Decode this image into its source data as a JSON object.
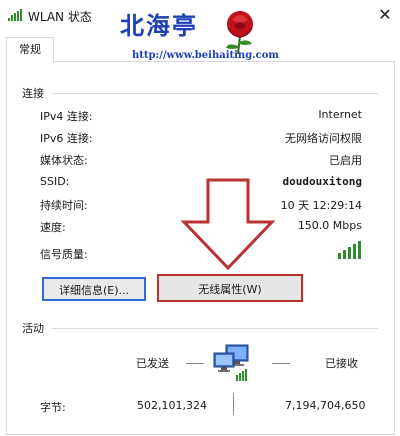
{
  "window": {
    "title": "WLAN 状态",
    "close_glyph": "✕"
  },
  "watermark": {
    "text": "北海亭",
    "url": "http://www.beihaiting.com"
  },
  "tabs": [
    {
      "label": "常规"
    }
  ],
  "connection": {
    "section_title": "连接",
    "rows": [
      {
        "label": "IPv4 连接:",
        "value": "Internet"
      },
      {
        "label": "IPv6 连接:",
        "value": "无网络访问权限"
      },
      {
        "label": "媒体状态:",
        "value": "已启用"
      },
      {
        "label": "SSID:",
        "value": "doudouxitong"
      },
      {
        "label": "持续时间:",
        "value": "10 天 12:29:14"
      },
      {
        "label": "速度:",
        "value": "150.0 Mbps"
      },
      {
        "label": "信号质量:",
        "value": ""
      }
    ],
    "signal_bars": 5,
    "signal_max": 5,
    "signal_color": "#2e8b2e"
  },
  "buttons": {
    "details": "详细信息(E)...",
    "wireless_properties": "无线属性(W)"
  },
  "activity": {
    "section_title": "活动",
    "sent_label": "已发送",
    "received_label": "已接收",
    "bytes_label": "字节:",
    "bytes_sent": "502,101,324",
    "bytes_received": "7,194,704,650"
  },
  "colors": {
    "highlight_red": "#b83232",
    "focus_blue": "#2f6ad9",
    "watermark_blue": "#1f3fb8"
  }
}
